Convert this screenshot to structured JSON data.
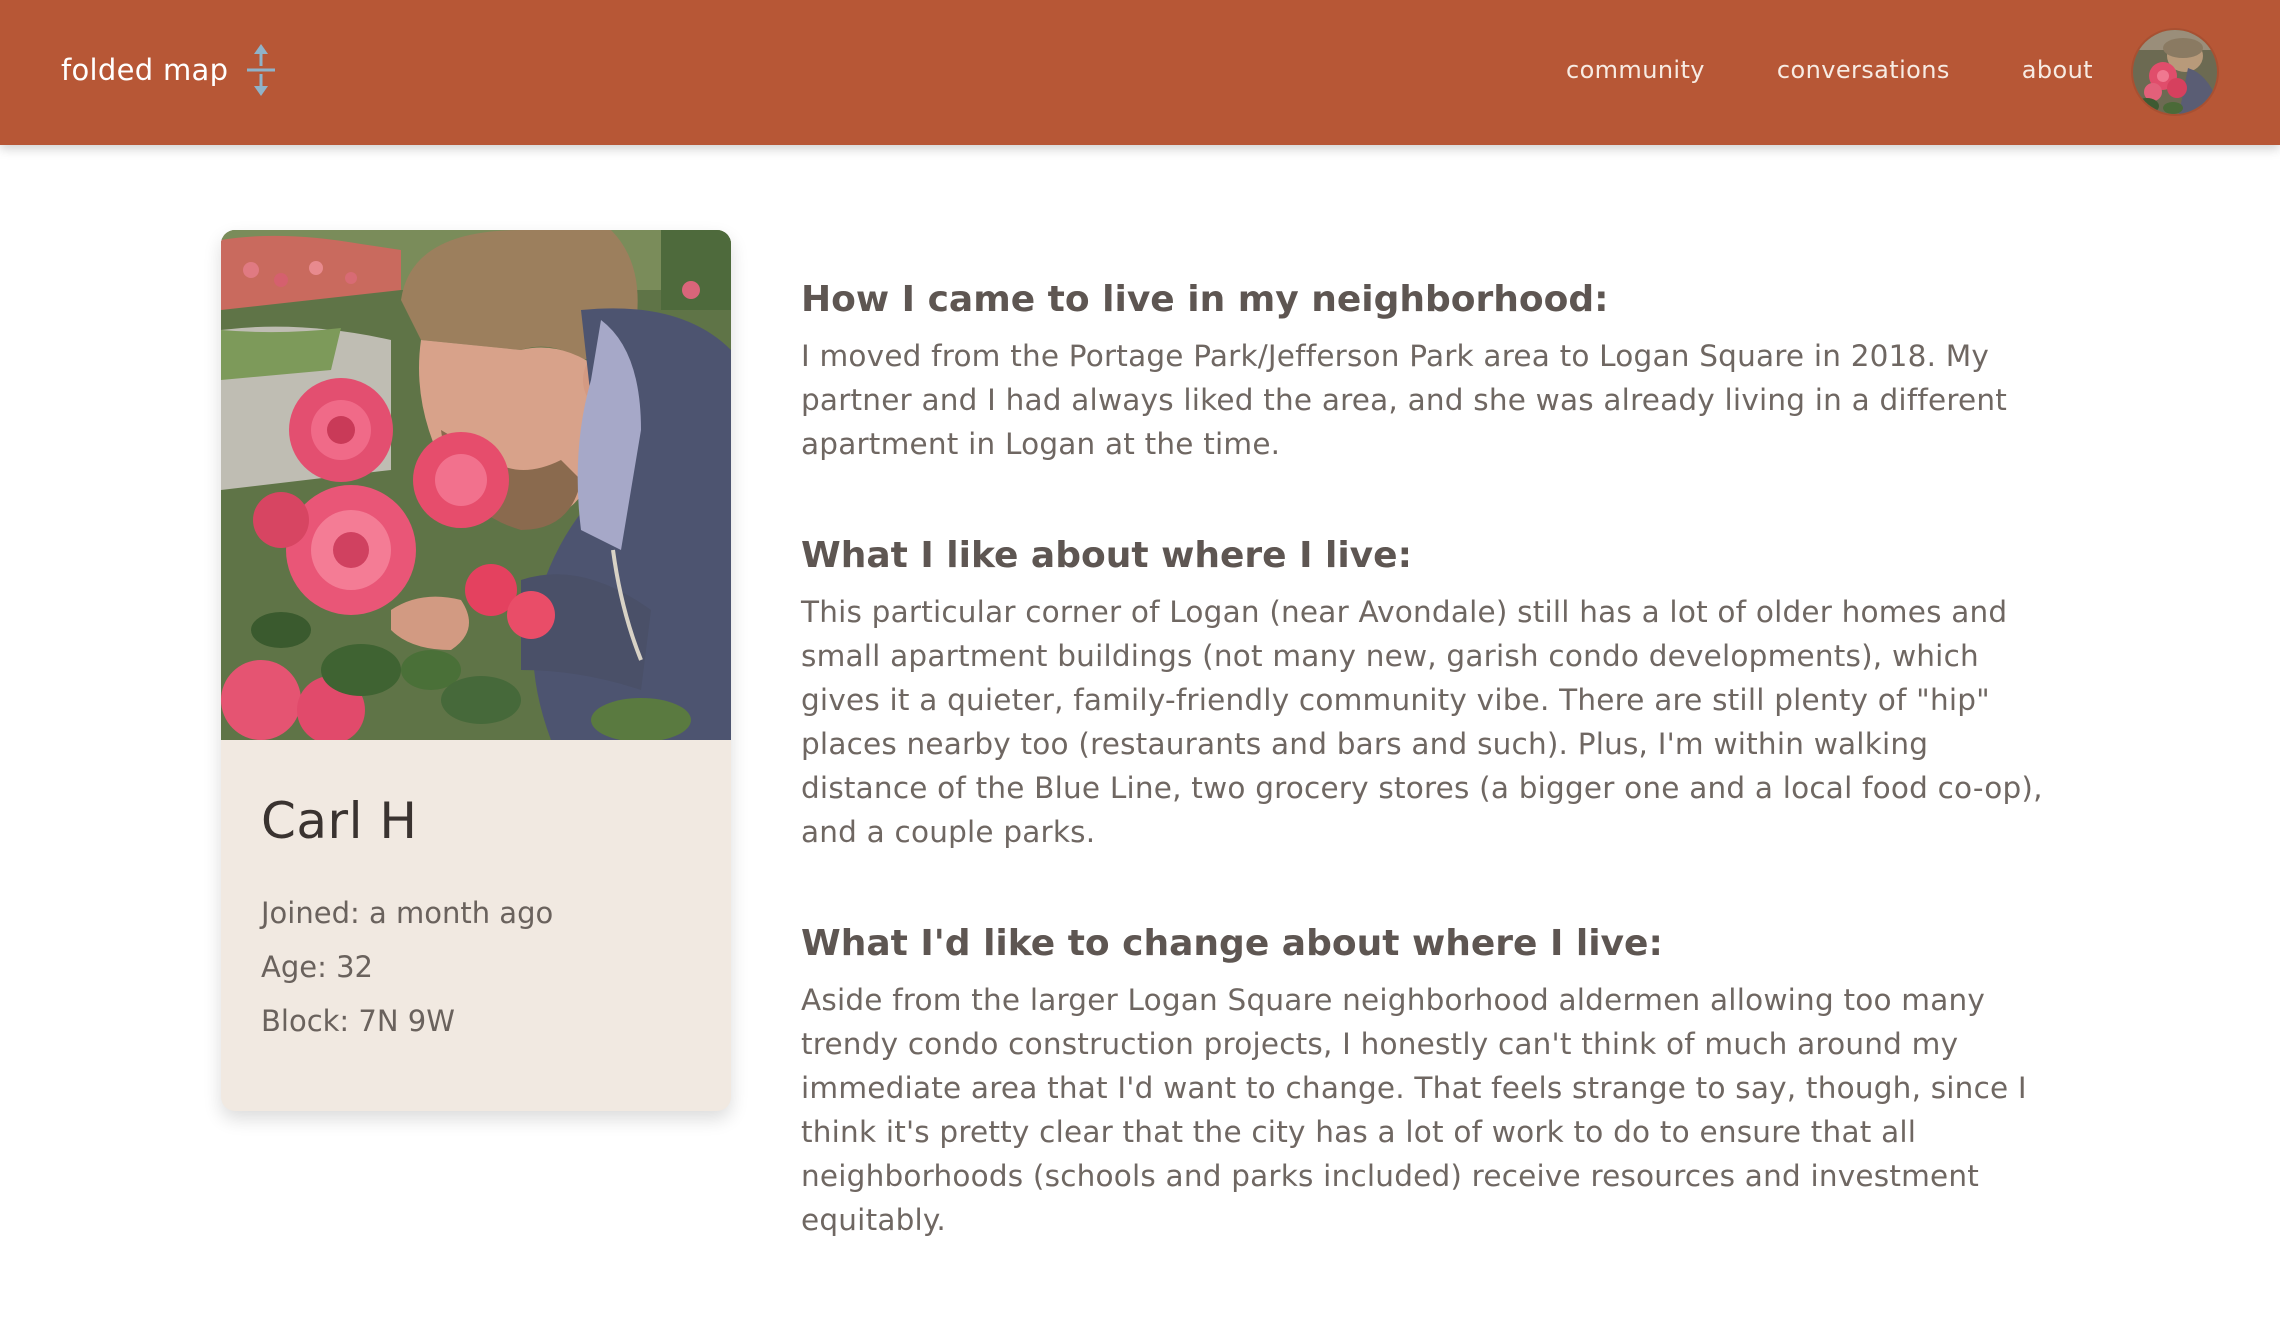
{
  "brand": {
    "name": "folded map",
    "icon": "folded-map-arrows-icon",
    "icon_color": "#8fb3c9"
  },
  "nav": {
    "items": [
      {
        "label": "community"
      },
      {
        "label": "conversations"
      },
      {
        "label": "about"
      }
    ]
  },
  "colors": {
    "header_bg": "#b75736",
    "card_bg": "#f1e9e1",
    "text": "#6a625d",
    "heading": "#5e5652"
  },
  "profile": {
    "photo": "profile-photo-man-smelling-roses",
    "name": "Carl H",
    "joined": "Joined: a month ago",
    "age": "Age: 32",
    "block": "Block: 7N 9W"
  },
  "sections": [
    {
      "heading": "How I came to live in my neighborhood:",
      "body": "I moved from the Portage Park/Jefferson Park area to Logan Square in 2018. My partner and I had always liked the area, and she was already living in a different apartment in Logan at the time."
    },
    {
      "heading": "What I like about where I live:",
      "body": "This particular corner of Logan (near Avondale) still has a lot of older homes and small apartment buildings (not many new, garish condo developments), which gives it a quieter, family-friendly community vibe. There are still plenty of \"hip\" places nearby too (restaurants and bars and such). Plus, I'm within walking distance of the Blue Line, two grocery stores (a bigger one and a local food co-op), and a couple parks."
    },
    {
      "heading": "What I'd like to change about where I live:",
      "body": "Aside from the larger Logan Square neighborhood aldermen allowing too many trendy condo construction projects, I honestly can't think of much around my immediate area that I'd want to change. That feels strange to say, though, since I think it's pretty clear that the city has a lot of work to do to ensure that all neighborhoods (schools and parks included) receive resources and investment equitably."
    }
  ]
}
